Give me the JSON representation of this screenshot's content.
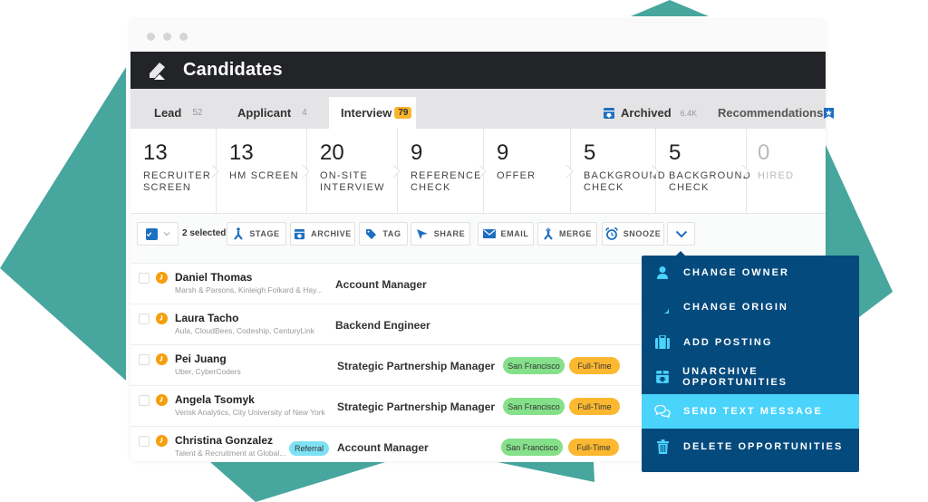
{
  "window": {
    "title": "Candidates"
  },
  "tabs": [
    {
      "label": "Lead",
      "count": "52"
    },
    {
      "label": "Applicant",
      "count": "4"
    },
    {
      "label": "Interview",
      "count": "79",
      "active": true
    },
    {
      "label": "Archived",
      "count": "6.4K",
      "icon": "archive-box-icon"
    },
    {
      "label": "Recommendations",
      "icon": "star-bookmark-icon"
    }
  ],
  "stages": [
    {
      "count": "13",
      "label": "Recruiter Screen"
    },
    {
      "count": "13",
      "label": "HM Screen"
    },
    {
      "count": "20",
      "label": "On-Site Interview"
    },
    {
      "count": "9",
      "label": "Reference Check"
    },
    {
      "count": "9",
      "label": "Offer"
    },
    {
      "count": "5",
      "label": "Background Check"
    },
    {
      "count": "5",
      "label": "Background Check"
    },
    {
      "count": "0",
      "label": "Hired"
    }
  ],
  "toolbar": {
    "selected_text": "2 selected",
    "buttons": [
      {
        "label": "STAGE",
        "icon": "stage-merge-icon"
      },
      {
        "label": "ARCHIVE",
        "icon": "archive-box-icon"
      },
      {
        "label": "TAG",
        "icon": "tag-icon"
      },
      {
        "label": "SHARE",
        "icon": "paper-plane-icon"
      },
      {
        "label": "EMAIL",
        "icon": "envelope-icon"
      },
      {
        "label": "MERGE",
        "icon": "merge-icon"
      },
      {
        "label": "SNOOZE",
        "icon": "alarm-clock-icon"
      }
    ],
    "more_icon": "chevron-down-icon"
  },
  "candidates": [
    {
      "name": "Daniel Thomas",
      "sub": "Marsh & Parsons, Kinleigh Folkard & Hay...",
      "role": "Account Manager",
      "tag": "",
      "location": "",
      "type": ""
    },
    {
      "name": "Laura Tacho",
      "sub": "Aula, CloudBees, Codeship, CenturyLink",
      "role": "Backend Engineer",
      "tag": "",
      "location": "",
      "type": ""
    },
    {
      "name": "Pei Juang",
      "sub": "Uber, CyberCoders",
      "role": "Strategic Partnership Manager",
      "tag": "",
      "location": "San Francisco",
      "type": "Full-Time"
    },
    {
      "name": "Angela Tsomyk",
      "sub": "Verisk Analytics, City University of New York",
      "role": "Strategic Partnership Manager",
      "tag": "",
      "location": "San Francisco",
      "type": "Full-Time"
    },
    {
      "name": "Christina Gonzalez",
      "sub": "Talent & Recruitment at Global...",
      "role": "Account Manager",
      "tag": "Referral",
      "location": "San Francisco",
      "type": "Full-Time"
    }
  ],
  "dropdown": {
    "items": [
      {
        "label": "CHANGE OWNER",
        "icon": "person-icon"
      },
      {
        "label": "CHANGE ORIGIN",
        "icon": "origin-bubble-icon"
      },
      {
        "label": "ADD POSTING",
        "icon": "briefcase-icon"
      },
      {
        "label": "UNARCHIVE OPPORTUNITIES",
        "icon": "unarchive-box-icon"
      },
      {
        "label": "SEND TEXT MESSAGE",
        "icon": "chat-bubbles-icon",
        "highlighted": true
      },
      {
        "label": "DELETE OPPORTUNITIES",
        "icon": "trash-icon"
      }
    ]
  },
  "colors": {
    "header_bg": "#232427",
    "accent_blue": "#1d6fbf",
    "badge_yellow": "#f9b52b",
    "dropdown_bg": "#044a7d",
    "dropdown_highlight": "#4ad3fb",
    "location_green": "#85e08a",
    "type_orange": "#fbb830",
    "referral_cyan": "#7ee2f5",
    "background_teal": "#47a69e"
  }
}
